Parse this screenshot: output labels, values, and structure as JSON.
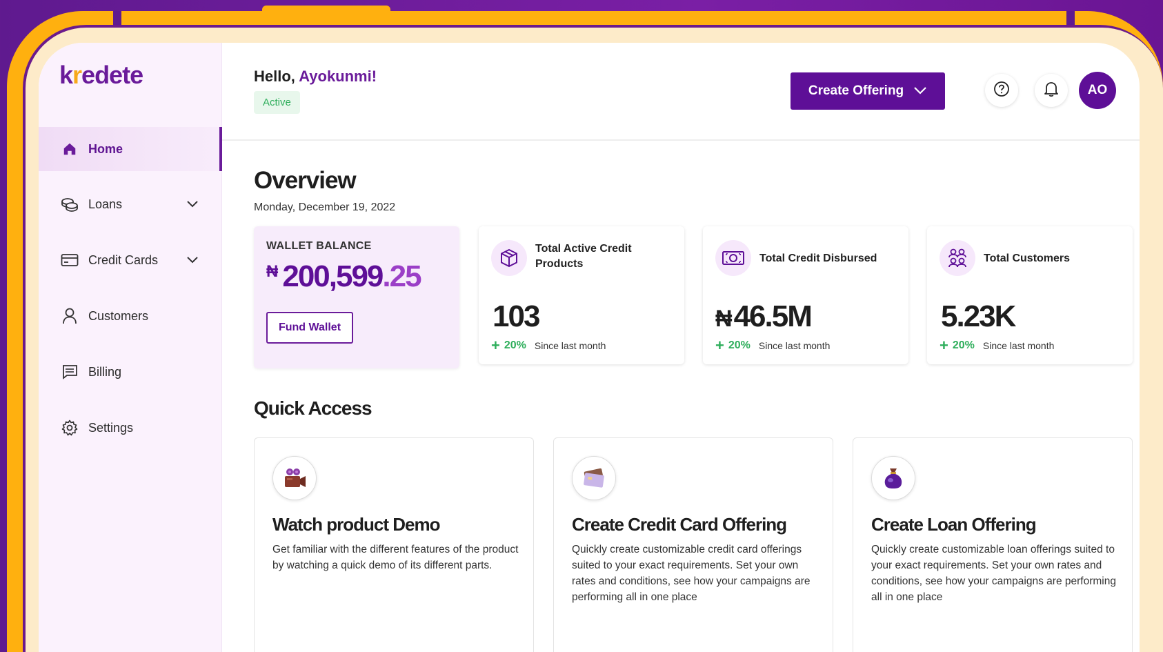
{
  "brand": {
    "logo_prefix": "k",
    "logo_accent": "r",
    "logo_suffix": "edete"
  },
  "sidebar": {
    "items": [
      {
        "label": "Home",
        "active": true
      },
      {
        "label": "Loans",
        "expandable": true
      },
      {
        "label": "Credit Cards",
        "expandable": true
      },
      {
        "label": "Customers"
      },
      {
        "label": "Billing"
      },
      {
        "label": "Settings"
      }
    ]
  },
  "header": {
    "greeting": "Hello,",
    "user_name": "Ayokunmi!",
    "status": "Active",
    "create_button": "Create Offering",
    "avatar_initials": "AO"
  },
  "overview": {
    "title": "Overview",
    "date": "Monday, December 19, 2022"
  },
  "wallet": {
    "label": "WALLET BALANCE",
    "currency": "₦",
    "amount_whole": "200,599",
    "amount_decimal": ".25",
    "fund_button": "Fund Wallet"
  },
  "stats": [
    {
      "title": "Total  Active Credit Products",
      "currency": "",
      "value": "103",
      "change": "20%",
      "since": "Since last month"
    },
    {
      "title": "Total Credit Disbursed",
      "currency": "₦",
      "value": "46.5M",
      "change": "20%",
      "since": "Since last month"
    },
    {
      "title": "Total Customers",
      "currency": "",
      "value": "5.23K",
      "change": "20%",
      "since": "Since last month"
    }
  ],
  "quick_access": {
    "title": "Quick Access",
    "cards": [
      {
        "heading": "Watch product Demo",
        "description": "Get familiar with the different features of the product by watching a quick demo of its different parts."
      },
      {
        "heading": "Create Credit Card Offering",
        "description": "Quickly create customizable credit card offerings suited to your exact requirements. Set your own rates and conditions, see how your campaigns are performing all in one place"
      },
      {
        "heading": "Create Loan Offering",
        "description": "Quickly create customizable loan offerings suited to your exact requirements. Set your own rates and conditions, see how your campaigns are performing all in one place"
      }
    ]
  },
  "colors": {
    "brand_purple": "#5e0f97",
    "accent_orange": "#f7a81b",
    "success_green": "#2eae5b",
    "frame_yellow": "#ffb00f",
    "background_purple": "#6b1a8c"
  }
}
